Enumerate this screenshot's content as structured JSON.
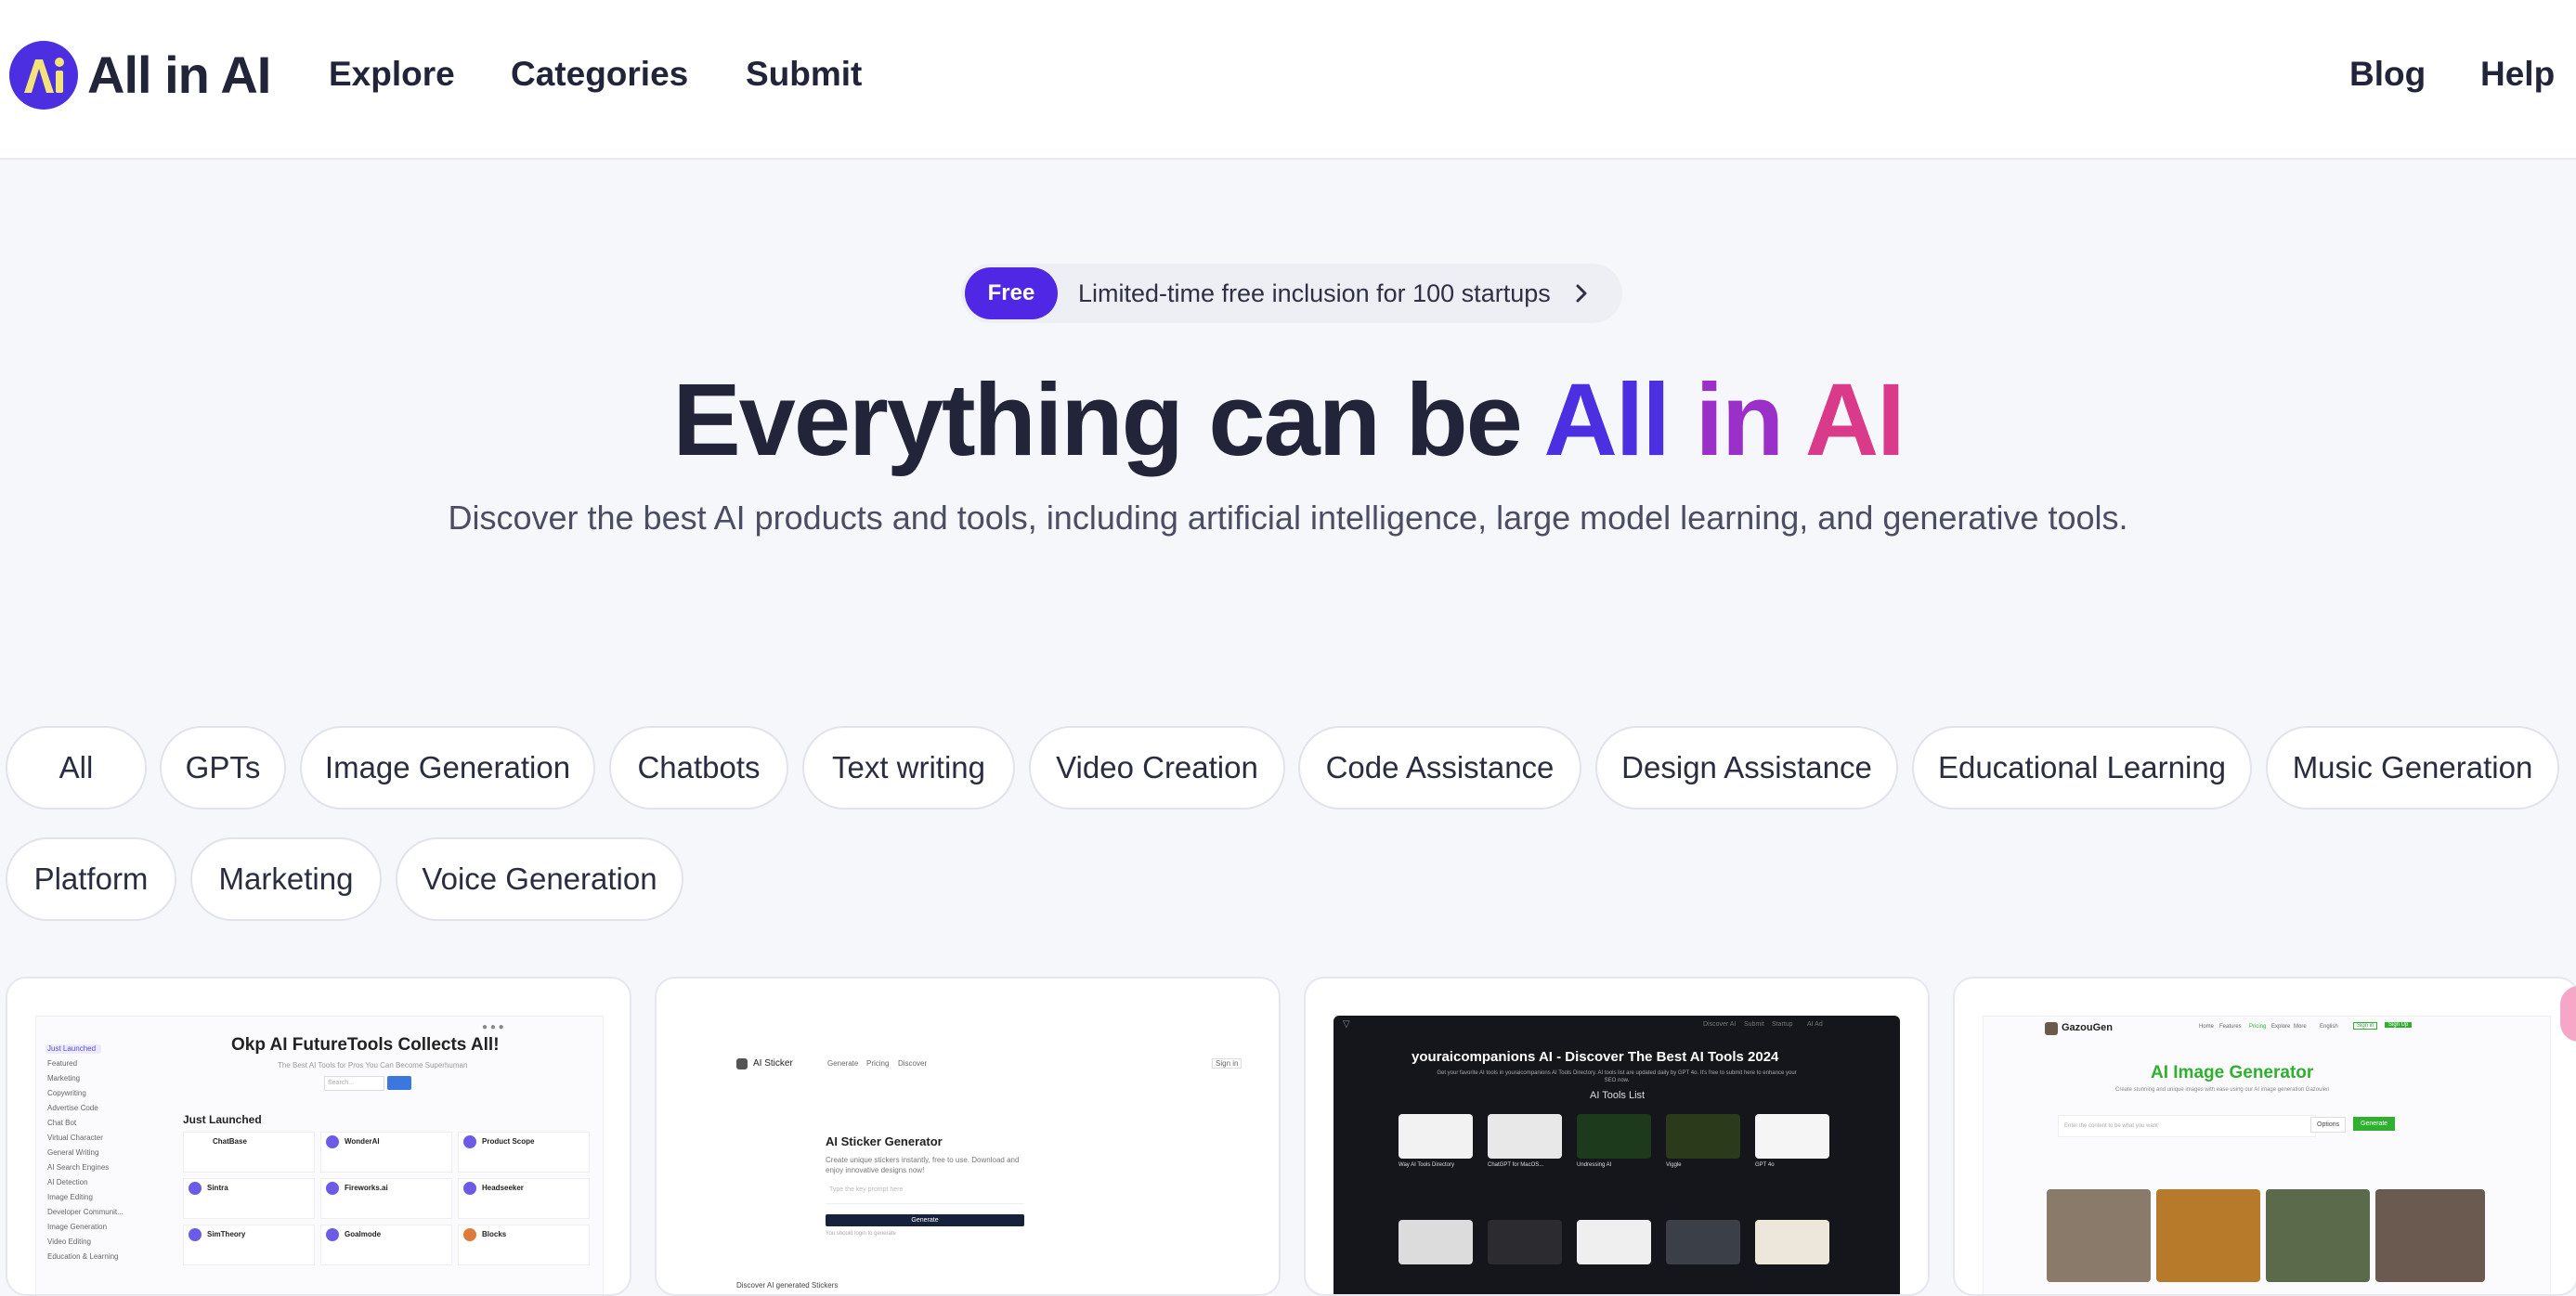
{
  "header": {
    "logo_text": "All in AI",
    "logo_glyph": "Ai",
    "nav": [
      "Explore",
      "Categories",
      "Submit"
    ],
    "nav_right": [
      "Blog",
      "Help"
    ]
  },
  "hero": {
    "promo_badge": "Free",
    "promo_text": "Limited-time free inclusion for 100 startups",
    "title_prefix": "Everything can be",
    "title_words": [
      "All",
      "in",
      "AI"
    ],
    "subtitle": "Discover the best AI products and tools, including artificial intelligence, large model learning, and generative tools."
  },
  "categories": [
    "All",
    "GPTs",
    "Image Generation",
    "Chatbots",
    "Text writing",
    "Video Creation",
    "Code Assistance",
    "Design Assistance",
    "Educational Learning",
    "Music Generation",
    "Platform",
    "Marketing",
    "Voice Generation"
  ],
  "cards": [
    {
      "title": "Okp AI FutureTools Collects All!",
      "tagline": "The Best AI Tools for Pros You Can Become Superhuman",
      "search_placeholder": "Search...",
      "section": "Just Launched",
      "sidebar": [
        "Just Launched",
        "Featured",
        "Marketing",
        "Copywriting",
        "Advertise Code",
        "Chat Bot",
        "Virtual Character",
        "General Writing",
        "AI Search Engines",
        "AI Detection",
        "Image Editing",
        "Developer Communit...",
        "Image Generation",
        "Video Editing",
        "Education & Learning"
      ],
      "items": [
        "ChatBase",
        "WonderAI",
        "Product Scope",
        "Sintra",
        "Fireworks.ai",
        "Headseeker",
        "SimTheory",
        "Goalmode",
        "Blocks"
      ]
    },
    {
      "brand": "AI Sticker",
      "nav": [
        "Generate",
        "Pricing",
        "Discover"
      ],
      "signin": "Sign in",
      "title": "AI Sticker Generator",
      "description": "Create unique stickers instantly, free to use. Download and enjoy innovative designs now!",
      "input_placeholder": "Type the key prompt here",
      "button": "Generate",
      "note": "You should login to generate",
      "section": "Discover AI generated Stickers"
    },
    {
      "top_links": [
        "Discover AI",
        "Submit",
        "Startup",
        "AI Ad"
      ],
      "title": "youraicompanions AI - Discover The Best AI Tools 2024",
      "subtitle": "Get your favorite AI tools in youraicompanions AI Tools Directory. AI tools list are updated daily by GPT 4o. It's free to submit here to enhance your SEO now.",
      "list_title": "AI Tools List",
      "tools": [
        "Way AI Tools Directory",
        "ChatGPT for MacOS...",
        "Undressing AI",
        "Viggle",
        "GPT 4o"
      ]
    },
    {
      "brand": "GazouGen",
      "nav": [
        "Home",
        "Features",
        "Pricing",
        "Explore",
        "More",
        "English",
        "Sign in",
        "Sign Up"
      ],
      "title": "AI Image Generator",
      "subtitle": "Create stunning and unique images with ease using our AI image generation Gazoulen",
      "input_placeholder": "Enter the content to be what you want",
      "options": "Options",
      "generate": "Generate"
    }
  ],
  "colors": {
    "brand": "#4b2fe0",
    "gradient": [
      "#4b2fe0",
      "#9b30c8",
      "#d93b8a"
    ],
    "badge": "#5127e6",
    "text": "#22243a",
    "muted": "#4a4d63",
    "background": "#f6f7fb"
  },
  "icons": {
    "promo_arrow": "chevron-right-icon"
  }
}
